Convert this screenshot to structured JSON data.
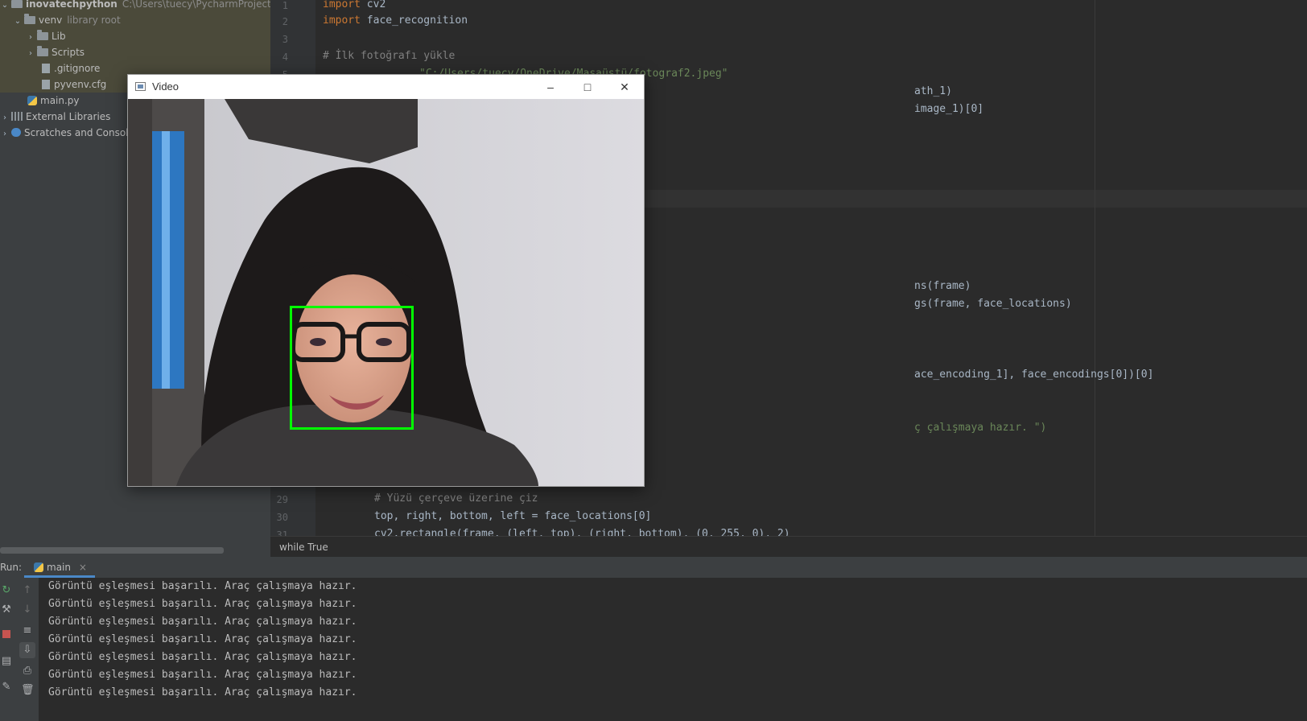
{
  "project": {
    "root_name": "inovatechpython",
    "root_path": "C:\\Users\\tuecy\\PycharmProjects\\inova",
    "venv_label": "venv",
    "venv_note": "library root",
    "items": [
      "Lib",
      "Scripts",
      ".gitignore",
      "pyvenv.cfg",
      "main.py",
      "External Libraries",
      "Scratches and Consoles"
    ]
  },
  "editor": {
    "line_numbers": [
      "1",
      "2",
      "3",
      "4",
      "5",
      "29",
      "30",
      "31"
    ],
    "lines": {
      "l1": "cv2",
      "l2": "face_recognition",
      "l4": "# İlk fotoğrafı yükle",
      "l5_str": "\"C:/Users/tuecy/OneDrive/Masaüstü/fotograf2.jpeg\"",
      "l6": "ath_1)",
      "l7": "image_1)[0]",
      "l16": "ns(frame)",
      "l17": "gs(frame, face_locations)",
      "l21": "ace_encoding_1], face_encodings[0])[0]",
      "l24": "ç çalışmaya hazır. \")",
      "l29": "# Yüzü çerçeve üzerine çiz",
      "l30": "top, right, bottom, left = face_locations[0]",
      "l31": "cv2.rectangle(frame, (left, top), (right, bottom), (0, 255, 0), 2)"
    },
    "keyword_import": "import",
    "breadcrumb": "while True"
  },
  "video_window": {
    "title": "Video",
    "min_icon": "minimize-icon",
    "max_icon": "maximize-icon",
    "close_icon": "close-icon",
    "box_color": "#00ff00"
  },
  "run": {
    "label": "Run:",
    "tab": "main",
    "output_lines": [
      "Görüntü eşleşmesi başarılı. Araç çalışmaya hazır.",
      "Görüntü eşleşmesi başarılı. Araç çalışmaya hazır.",
      "Görüntü eşleşmesi başarılı. Araç çalışmaya hazır.",
      "Görüntü eşleşmesi başarılı. Araç çalışmaya hazır.",
      "Görüntü eşleşmesi başarılı. Araç çalışmaya hazır.",
      "Görüntü eşleşmesi başarılı. Araç çalışmaya hazır.",
      "Görüntü eşleşmesi başarılı. Araç çalışmaya hazır."
    ]
  }
}
